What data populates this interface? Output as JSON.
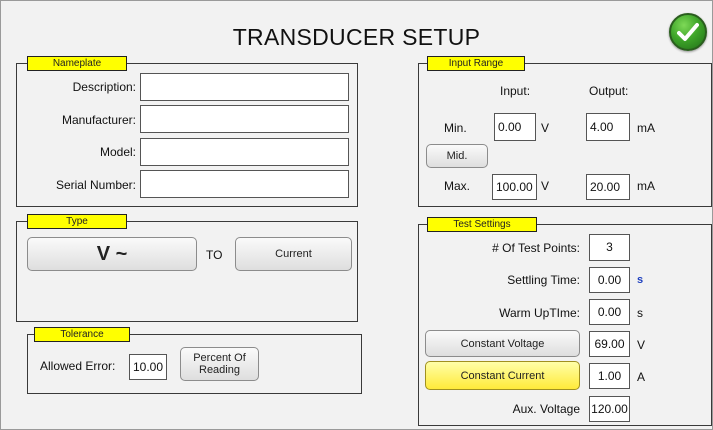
{
  "title": "TRANSDUCER SETUP",
  "check_icon": "checkmark-icon",
  "nameplate": {
    "title": "Nameplate",
    "fields": [
      {
        "label": "Description:",
        "value": ""
      },
      {
        "label": "Manufacturer:",
        "value": ""
      },
      {
        "label": "Model:",
        "value": ""
      },
      {
        "label": "Serial Number:",
        "value": ""
      }
    ]
  },
  "type": {
    "title": "Type",
    "input_type": "V ~",
    "to_label": "TO",
    "output_type": "Current"
  },
  "tolerance": {
    "title": "Tolerance",
    "allowed_error_label": "Allowed Error:",
    "allowed_error_value": "10.00",
    "mode_button": "Percent Of Reading"
  },
  "input_range": {
    "title": "Input Range",
    "input_header": "Input:",
    "output_header": "Output:",
    "min_label": "Min.",
    "min_input": "0.00",
    "min_input_unit": "V",
    "min_output": "4.00",
    "min_output_unit": "mA",
    "mid_button": "Mid.",
    "max_label": "Max.",
    "max_input": "100.00",
    "max_input_unit": "V",
    "max_output": "20.00",
    "max_output_unit": "mA"
  },
  "test_settings": {
    "title": "Test Settings",
    "test_points_label": "# Of Test Points:",
    "test_points_value": "3",
    "settling_label": "Settling Time:",
    "settling_value": "0.00",
    "settling_unit": "s",
    "warmup_label": "Warm UpTIme:",
    "warmup_value": "0.00",
    "warmup_unit": "s",
    "const_voltage_button": "Constant Voltage",
    "const_voltage_value": "69.00",
    "const_voltage_unit": "V",
    "const_current_button": "Constant Current",
    "const_current_value": "1.00",
    "const_current_unit": "A",
    "aux_label": "Aux. Voltage",
    "aux_value": "120.00"
  },
  "colors": {
    "accent_yellow": "#ffff00",
    "selected_button": "#ffea3a",
    "check_green": "#3fa52a"
  }
}
